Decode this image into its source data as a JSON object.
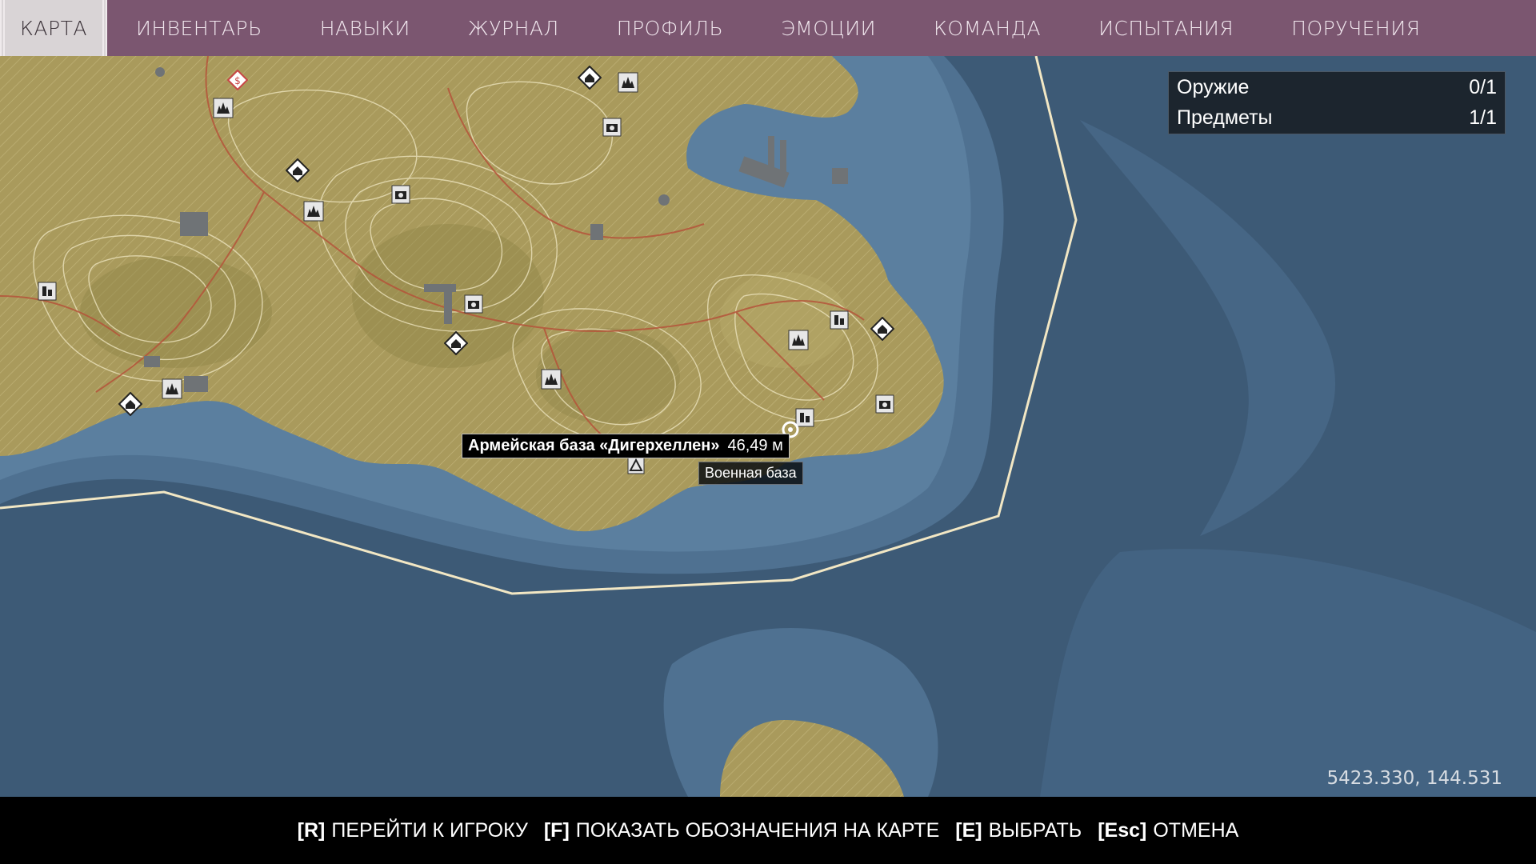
{
  "nav": {
    "tabs": [
      {
        "label": "КАРТА"
      },
      {
        "label": "ИНВЕНТАРЬ"
      },
      {
        "label": "НАВЫКИ"
      },
      {
        "label": "ЖУРНАЛ"
      },
      {
        "label": "ПРОФИЛЬ"
      },
      {
        "label": "ЭМОЦИИ"
      },
      {
        "label": "КОМАНДА"
      },
      {
        "label": "ИСПЫТАНИЯ"
      },
      {
        "label": "ПОРУЧЕНИЯ"
      }
    ],
    "active": "КАРТА"
  },
  "objectives": {
    "rows": [
      {
        "label": "Оружие",
        "value": "0/1"
      },
      {
        "label": "Предметы",
        "value": "1/1"
      }
    ]
  },
  "tooltip": {
    "name": "Армейская база «Дигерхеллен»",
    "distance": "46,49 м",
    "type": "Военная база"
  },
  "coordinates": "5423.330, 144.531",
  "hints": [
    {
      "key": "[R]",
      "label": "ПЕРЕЙТИ К ИГРОКУ"
    },
    {
      "key": "[F]",
      "label": "ПОКАЗАТЬ ОБОЗНАЧЕНИЯ НА КАРТЕ"
    },
    {
      "key": "[E]",
      "label": "ВЫБРАТЬ"
    },
    {
      "key": "[Esc]",
      "label": "ОТМЕНА"
    }
  ],
  "colors": {
    "nav_bg": "#7b5670",
    "sea_deep": "#3d5a76",
    "sea_shallow": "#5f87a8",
    "land": "#a99a5c",
    "boundary": "#f2e7c4"
  },
  "map_icons": [
    "house-icon",
    "landmark-icon",
    "camera-icon",
    "military-icon",
    "player-marker-icon"
  ]
}
